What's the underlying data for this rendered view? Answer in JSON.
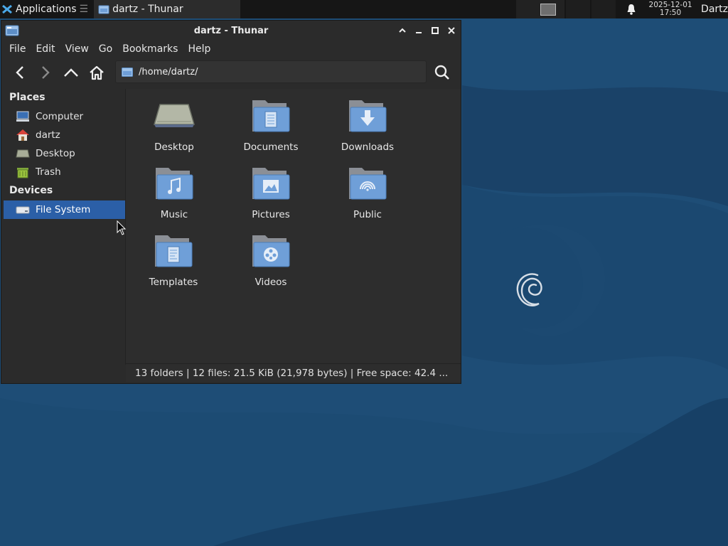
{
  "panel": {
    "applications_label": "Applications",
    "task_label": "dartz - Thunar",
    "clock_date": "2025-12-01",
    "clock_time": "17:50",
    "user_label": "Dartz"
  },
  "window": {
    "title": "dartz - Thunar",
    "menu": [
      "File",
      "Edit",
      "View",
      "Go",
      "Bookmarks",
      "Help"
    ],
    "location": "/home/dartz/"
  },
  "sidebar": {
    "places_heading": "Places",
    "places": [
      {
        "label": "Computer",
        "icon": "computer-icon"
      },
      {
        "label": "dartz",
        "icon": "home-icon"
      },
      {
        "label": "Desktop",
        "icon": "desktop-icon"
      },
      {
        "label": "Trash",
        "icon": "trash-icon"
      }
    ],
    "devices_heading": "Devices",
    "devices": [
      {
        "label": "File System",
        "icon": "drive-icon",
        "selected": true
      }
    ]
  },
  "files": [
    {
      "label": "Desktop",
      "icon": "desktop-folder-icon"
    },
    {
      "label": "Documents",
      "icon": "documents-folder-icon"
    },
    {
      "label": "Downloads",
      "icon": "downloads-folder-icon"
    },
    {
      "label": "Music",
      "icon": "music-folder-icon"
    },
    {
      "label": "Pictures",
      "icon": "pictures-folder-icon"
    },
    {
      "label": "Public",
      "icon": "public-folder-icon"
    },
    {
      "label": "Templates",
      "icon": "templates-folder-icon"
    },
    {
      "label": "Videos",
      "icon": "videos-folder-icon"
    }
  ],
  "status": "13 folders  |  12 files: 21.5 KiB (21,978 bytes)  |  Free space: 42.4 ...",
  "colors": {
    "selection": "#2b5fa7",
    "folder": "#6f9fd8",
    "desktop_bg": "#1f4f78"
  }
}
